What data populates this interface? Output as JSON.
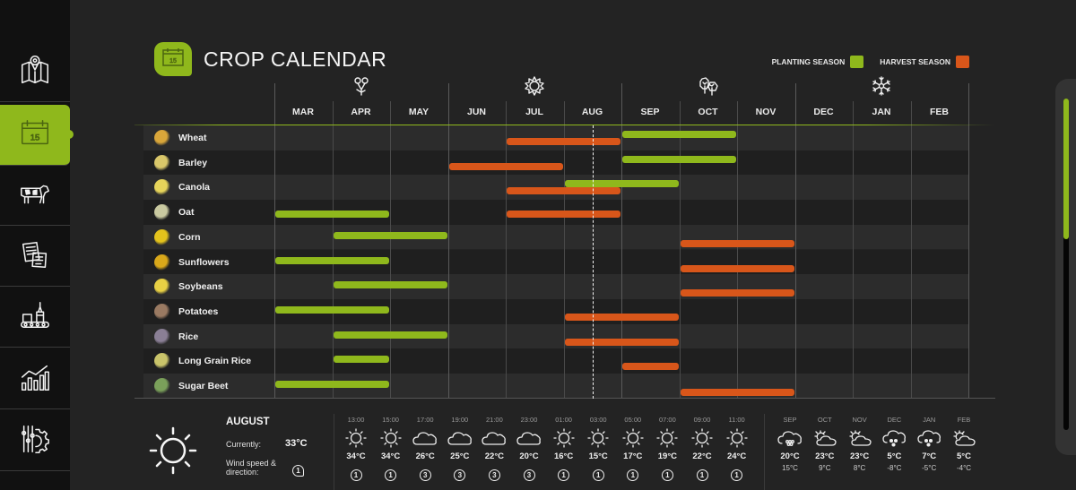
{
  "title": "CROP CALENDAR",
  "title_badge_day": "15",
  "sidebar": {
    "items": [
      {
        "name": "map",
        "icon": "map-pin-icon",
        "active": false
      },
      {
        "name": "calendar",
        "icon": "calendar-icon",
        "active": true,
        "day": "15"
      },
      {
        "name": "livestock",
        "icon": "cow-icon",
        "active": false
      },
      {
        "name": "documents",
        "icon": "documents-icon",
        "active": false
      },
      {
        "name": "production",
        "icon": "factory-conveyor-icon",
        "active": false
      },
      {
        "name": "statistics",
        "icon": "bar-chart-icon",
        "active": false
      },
      {
        "name": "settings",
        "icon": "settings-sliders-icon",
        "active": false
      }
    ]
  },
  "legend": {
    "planting_label": "PLANTING SEASON",
    "harvest_label": "HARVEST SEASON",
    "planting_color": "#8fb81c",
    "harvest_color": "#d8561a"
  },
  "seasons": [
    {
      "name": "spring",
      "icon": "flowers-icon",
      "month": "APR"
    },
    {
      "name": "summer",
      "icon": "sun-icon",
      "month": "JUL"
    },
    {
      "name": "autumn",
      "icon": "leaves-icon",
      "month": "OCT"
    },
    {
      "name": "winter",
      "icon": "snowflake-icon",
      "month": "JAN"
    }
  ],
  "chart_data": {
    "type": "gantt",
    "title": "CROP CALENDAR",
    "months": [
      "MAR",
      "APR",
      "MAY",
      "JUN",
      "JUL",
      "AUG",
      "SEP",
      "OCT",
      "NOV",
      "DEC",
      "JAN",
      "FEB"
    ],
    "current_position_month": 5.5,
    "current_month": "AUG",
    "crops": [
      {
        "name": "Wheat",
        "icon_color": "#d9a63a",
        "planting": [
          "SEP",
          "OCT"
        ],
        "harvest": [
          "JUL",
          "AUG"
        ]
      },
      {
        "name": "Barley",
        "icon_color": "#d9c76a",
        "planting": [
          "SEP",
          "OCT"
        ],
        "harvest": [
          "JUN",
          "JUL"
        ]
      },
      {
        "name": "Canola",
        "icon_color": "#e6d45a",
        "planting": [
          "AUG",
          "SEP"
        ],
        "harvest": [
          "JUL",
          "AUG"
        ]
      },
      {
        "name": "Oat",
        "icon_color": "#c9c9a0",
        "planting": [
          "MAR",
          "APR"
        ],
        "harvest": [
          "JUL",
          "AUG"
        ]
      },
      {
        "name": "Corn",
        "icon_color": "#e3c21c",
        "planting": [
          "APR",
          "MAY"
        ],
        "harvest": [
          "OCT",
          "NOV"
        ]
      },
      {
        "name": "Sunflowers",
        "icon_color": "#d9a81a",
        "planting": [
          "MAR",
          "APR"
        ],
        "harvest": [
          "OCT",
          "NOV"
        ]
      },
      {
        "name": "Soybeans",
        "icon_color": "#e8d044",
        "planting": [
          "APR",
          "MAY"
        ],
        "harvest": [
          "OCT",
          "NOV"
        ]
      },
      {
        "name": "Potatoes",
        "icon_color": "#9a7a62",
        "planting": [
          "MAR",
          "APR"
        ],
        "harvest": [
          "AUG",
          "SEP"
        ]
      },
      {
        "name": "Rice",
        "icon_color": "#8a7f95",
        "planting": [
          "APR",
          "MAY"
        ],
        "harvest": [
          "AUG",
          "SEP"
        ]
      },
      {
        "name": "Long Grain Rice",
        "icon_color": "#c9c46a",
        "planting": [
          "APR",
          "APR"
        ],
        "harvest": [
          "SEP",
          "SEP"
        ]
      },
      {
        "name": "Sugar Beet",
        "icon_color": "#7aa05a",
        "planting": [
          "MAR",
          "APR"
        ],
        "harvest": [
          "OCT",
          "NOV"
        ]
      }
    ]
  },
  "weather": {
    "month": "AUGUST",
    "currently_label": "Currently:",
    "currently_value": "33°C",
    "wind_label": "Wind speed & direction:",
    "wind_value": "1",
    "hourly": [
      {
        "time": "13:00",
        "icon": "sun-icon",
        "temp": "34°C",
        "wind": "1"
      },
      {
        "time": "15:00",
        "icon": "sun-icon",
        "temp": "34°C",
        "wind": "1"
      },
      {
        "time": "17:00",
        "icon": "cloud-icon",
        "temp": "26°C",
        "wind": "3"
      },
      {
        "time": "19:00",
        "icon": "cloud-icon",
        "temp": "25°C",
        "wind": "3"
      },
      {
        "time": "21:00",
        "icon": "cloud-icon",
        "temp": "22°C",
        "wind": "3"
      },
      {
        "time": "23:00",
        "icon": "cloud-icon",
        "temp": "20°C",
        "wind": "3"
      },
      {
        "time": "01:00",
        "icon": "sun-icon",
        "temp": "16°C",
        "wind": "1"
      },
      {
        "time": "03:00",
        "icon": "sun-icon",
        "temp": "15°C",
        "wind": "1"
      },
      {
        "time": "05:00",
        "icon": "sun-icon",
        "temp": "17°C",
        "wind": "1"
      },
      {
        "time": "07:00",
        "icon": "sun-icon",
        "temp": "19°C",
        "wind": "1"
      },
      {
        "time": "09:00",
        "icon": "sun-icon",
        "temp": "22°C",
        "wind": "1"
      },
      {
        "time": "11:00",
        "icon": "sun-icon",
        "temp": "24°C",
        "wind": "1"
      }
    ],
    "monthly": [
      {
        "month": "SEP",
        "icon": "hail-cloud-icon",
        "high": "20°C",
        "low": "15°C"
      },
      {
        "month": "OCT",
        "icon": "partly-cloudy-icon",
        "high": "23°C",
        "low": "9°C"
      },
      {
        "month": "NOV",
        "icon": "partly-cloudy-icon",
        "high": "23°C",
        "low": "8°C"
      },
      {
        "month": "DEC",
        "icon": "snow-cloud-icon",
        "high": "5°C",
        "low": "-8°C"
      },
      {
        "month": "JAN",
        "icon": "snow-cloud-icon",
        "high": "7°C",
        "low": "-5°C"
      },
      {
        "month": "FEB",
        "icon": "partly-cloudy-icon",
        "high": "5°C",
        "low": "-4°C"
      }
    ]
  }
}
